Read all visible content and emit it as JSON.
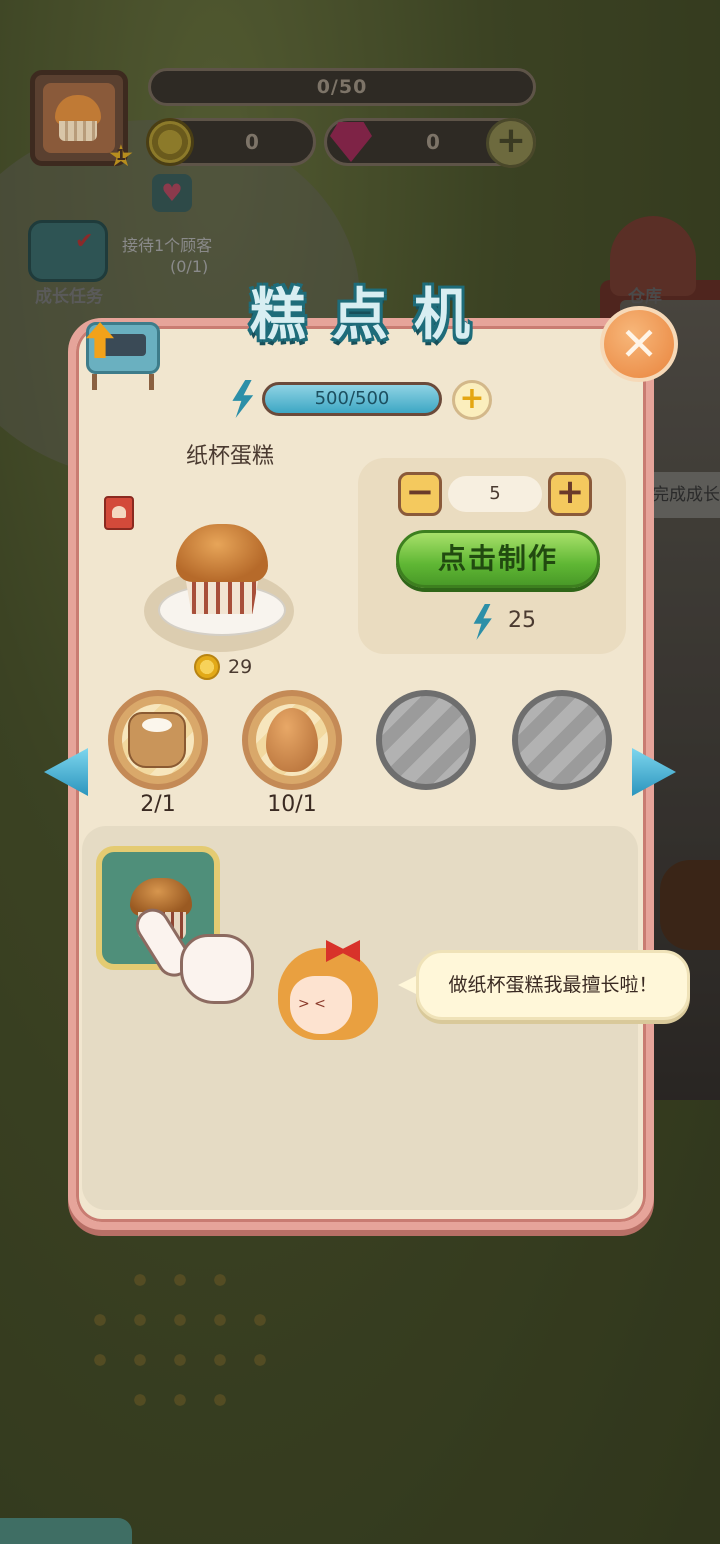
{
  "hud": {
    "exp_progress": "0/50",
    "coins": "0",
    "gems": "0",
    "player_level": "1",
    "task_label": "成长任务",
    "task_description": "接待1个顾客",
    "task_progress": "(0/1)",
    "warehouse_label": "仓库",
    "background_banner_fragment": "完成成长任"
  },
  "panel": {
    "title": "糕点机",
    "close_symbol": "✕"
  },
  "energy": {
    "current": 500,
    "max": 500,
    "display": "500/500",
    "plus_symbol": "+"
  },
  "product": {
    "name": "纸杯蛋糕",
    "price": "29"
  },
  "production": {
    "quantity": "5",
    "minus_symbol": "−",
    "plus_symbol": "+",
    "make_label": "点击制作",
    "energy_cost": "25"
  },
  "ingredients": [
    {
      "name": "flour",
      "count": "2/1"
    },
    {
      "name": "egg",
      "count": "10/1"
    },
    {
      "name": "empty",
      "count": ""
    },
    {
      "name": "empty",
      "count": ""
    }
  ],
  "tutorial": {
    "speech": "做纸杯蛋糕我最擅长啦！"
  },
  "colors": {
    "panel_bg": "#f1e6cf",
    "panel_border": "#e6a49a",
    "title_outline": "#1e6c7a",
    "make_button": "#5fb734",
    "energy_bar": "#3da7c4",
    "close_button": "#e9843d"
  },
  "icons": {
    "energy": "lightning-bolt",
    "coin": "gold-coin",
    "gem": "red-gem",
    "close": "x-mark",
    "recipe": "recipe-book",
    "nav_left": "triangle-left",
    "nav_right": "triangle-right",
    "pointer": "tap-hand"
  }
}
